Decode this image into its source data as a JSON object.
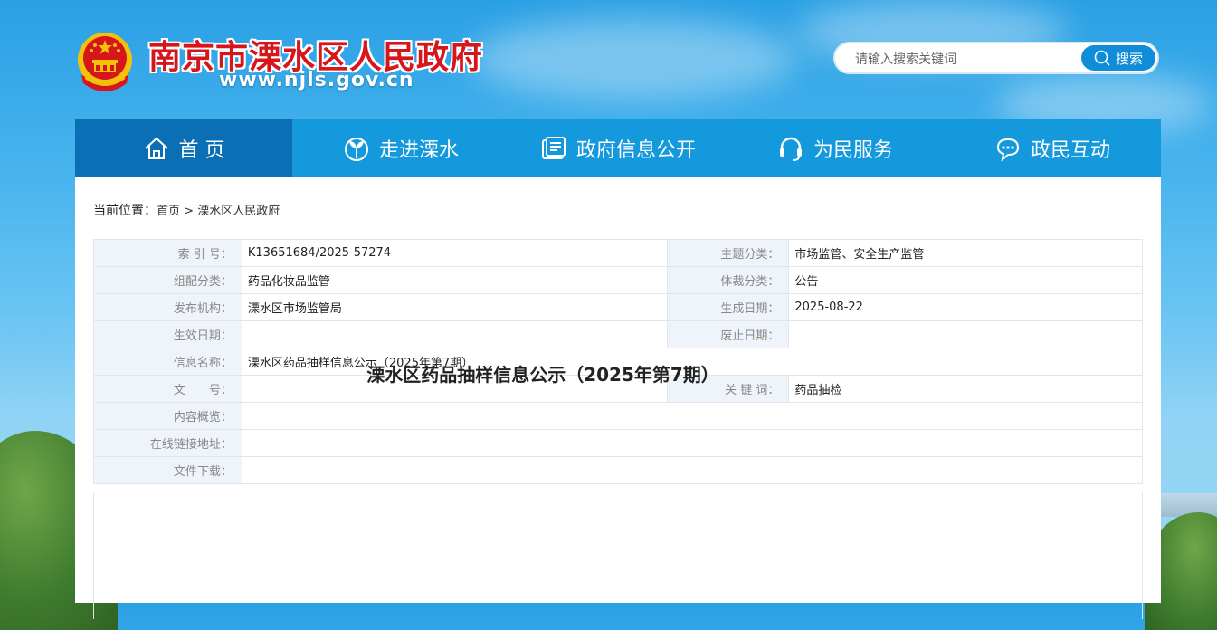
{
  "header": {
    "site_title": "南京市溧水区人民政府",
    "site_url": "www.njls.gov.cn",
    "emblem_icon": "national-emblem-icon"
  },
  "search": {
    "placeholder": "请输入搜索关键词",
    "button_label": "搜索"
  },
  "nav": {
    "items": [
      {
        "label": "首 页",
        "icon": "home-icon",
        "active": true
      },
      {
        "label": "走进溧水",
        "icon": "sprout-icon",
        "active": false
      },
      {
        "label": "政府信息公开",
        "icon": "document-list-icon",
        "active": false
      },
      {
        "label": "为民服务",
        "icon": "headset-icon",
        "active": false
      },
      {
        "label": "政民互动",
        "icon": "chat-bubble-icon",
        "active": false
      }
    ]
  },
  "breadcrumb": {
    "lead": "当前位置：",
    "home": "首页",
    "sep": ">",
    "current": "溧水区人民政府"
  },
  "meta": {
    "index_no_label": "索 引 号：",
    "index_no": "K13651684/2025-57274",
    "subject_label": "主题分类：",
    "subject": "市场监管、安全生产监管",
    "category_label": "组配分类：",
    "category": "药品化妆品监管",
    "genre_label": "体裁分类：",
    "genre": "公告",
    "publisher_label": "发布机构：",
    "publisher": "溧水区市场监管局",
    "created_label": "生成日期：",
    "created": "2025-08-22",
    "effective_label": "生效日期：",
    "effective": "",
    "expiry_label": "废止日期：",
    "expiry": "",
    "info_name_label": "信息名称：",
    "info_name": "溧水区药品抽样信息公示（2025年第7期）",
    "doc_no_label": "文　　号：",
    "doc_no": "",
    "keywords_label": "关 键 词：",
    "keywords": "药品抽检",
    "summary_label": "内容概览：",
    "summary": "",
    "link_label": "在线链接地址：",
    "link": "",
    "download_label": "文件下载：",
    "download": ""
  },
  "article": {
    "title": "溧水区药品抽样信息公示（2025年第7期）"
  },
  "colors": {
    "brand_red": "#d7161c",
    "nav_blue": "#1499dc",
    "nav_active": "#0a6fb5"
  }
}
